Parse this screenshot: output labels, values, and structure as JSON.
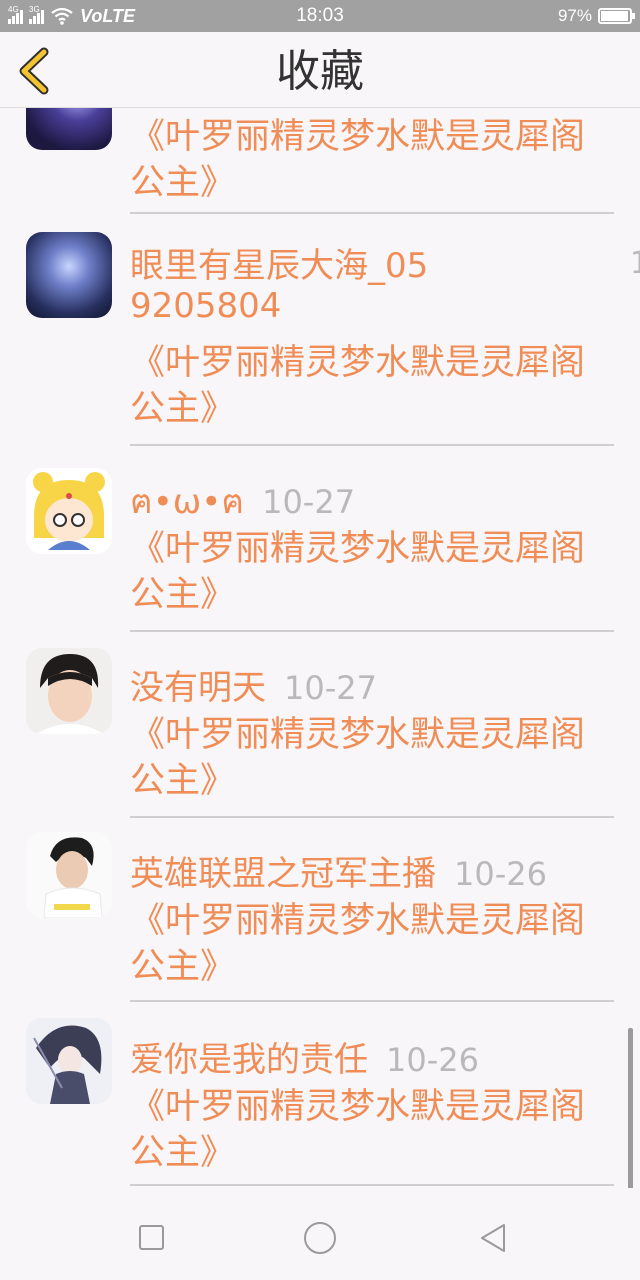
{
  "status_bar": {
    "net1": "4G",
    "net2": "3G",
    "volte": "VoLTE",
    "time": "18:03",
    "battery": "97%",
    "battery_level": 0.97
  },
  "header": {
    "title": "收藏"
  },
  "items": [
    {
      "content": "《叶罗丽精灵梦水默是灵犀阁公主》"
    },
    {
      "name": "眼里有星辰大海_059205804",
      "content": "《叶罗丽精灵梦水默是灵犀阁公主》",
      "side_date": "1"
    },
    {
      "name": "ฅ•ω•ฅ",
      "date": "10-27",
      "content": "《叶罗丽精灵梦水默是灵犀阁公主》"
    },
    {
      "name": "没有明天",
      "date": "10-27",
      "content": "《叶罗丽精灵梦水默是灵犀阁公主》"
    },
    {
      "name": "英雄联盟之冠军主播",
      "date": "10-26",
      "content": "《叶罗丽精灵梦水默是灵犀阁公主》"
    },
    {
      "name": "爱你是我的责任",
      "date": "10-26",
      "content": "《叶罗丽精灵梦水默是灵犀阁公主》"
    }
  ],
  "colors": {
    "accent": "#f08d57",
    "date": "#b9b9b9",
    "back_arrow": "#f4c430"
  },
  "icons": [
    "back-arrow-icon",
    "nav-recents-icon",
    "nav-home-icon",
    "nav-back-icon",
    "wifi-icon",
    "battery-icon"
  ]
}
